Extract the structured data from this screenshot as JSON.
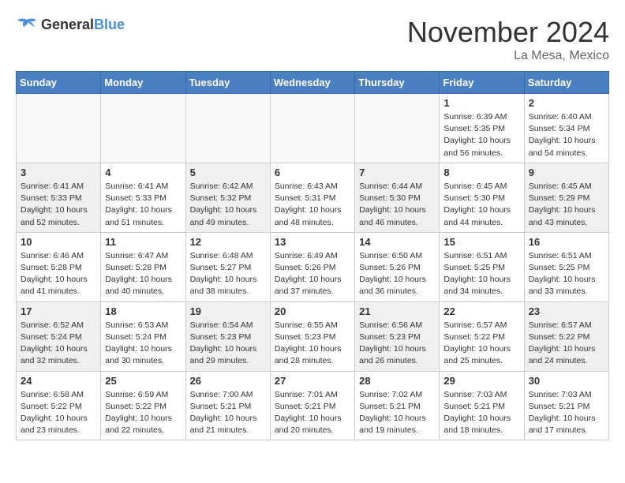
{
  "header": {
    "logo": {
      "general": "General",
      "blue": "Blue"
    },
    "title": "November 2024",
    "location": "La Mesa, Mexico"
  },
  "weekdays": [
    "Sunday",
    "Monday",
    "Tuesday",
    "Wednesday",
    "Thursday",
    "Friday",
    "Saturday"
  ],
  "weeks": [
    [
      {
        "day": null,
        "info": null
      },
      {
        "day": null,
        "info": null
      },
      {
        "day": null,
        "info": null
      },
      {
        "day": null,
        "info": null
      },
      {
        "day": null,
        "info": null
      },
      {
        "day": "1",
        "info": "Sunrise: 6:39 AM\nSunset: 5:35 PM\nDaylight: 10 hours and 56 minutes."
      },
      {
        "day": "2",
        "info": "Sunrise: 6:40 AM\nSunset: 5:34 PM\nDaylight: 10 hours and 54 minutes."
      }
    ],
    [
      {
        "day": "3",
        "info": "Sunrise: 6:41 AM\nSunset: 5:33 PM\nDaylight: 10 hours and 52 minutes."
      },
      {
        "day": "4",
        "info": "Sunrise: 6:41 AM\nSunset: 5:33 PM\nDaylight: 10 hours and 51 minutes."
      },
      {
        "day": "5",
        "info": "Sunrise: 6:42 AM\nSunset: 5:32 PM\nDaylight: 10 hours and 49 minutes."
      },
      {
        "day": "6",
        "info": "Sunrise: 6:43 AM\nSunset: 5:31 PM\nDaylight: 10 hours and 48 minutes."
      },
      {
        "day": "7",
        "info": "Sunrise: 6:44 AM\nSunset: 5:30 PM\nDaylight: 10 hours and 46 minutes."
      },
      {
        "day": "8",
        "info": "Sunrise: 6:45 AM\nSunset: 5:30 PM\nDaylight: 10 hours and 44 minutes."
      },
      {
        "day": "9",
        "info": "Sunrise: 6:45 AM\nSunset: 5:29 PM\nDaylight: 10 hours and 43 minutes."
      }
    ],
    [
      {
        "day": "10",
        "info": "Sunrise: 6:46 AM\nSunset: 5:28 PM\nDaylight: 10 hours and 41 minutes."
      },
      {
        "day": "11",
        "info": "Sunrise: 6:47 AM\nSunset: 5:28 PM\nDaylight: 10 hours and 40 minutes."
      },
      {
        "day": "12",
        "info": "Sunrise: 6:48 AM\nSunset: 5:27 PM\nDaylight: 10 hours and 38 minutes."
      },
      {
        "day": "13",
        "info": "Sunrise: 6:49 AM\nSunset: 5:26 PM\nDaylight: 10 hours and 37 minutes."
      },
      {
        "day": "14",
        "info": "Sunrise: 6:50 AM\nSunset: 5:26 PM\nDaylight: 10 hours and 36 minutes."
      },
      {
        "day": "15",
        "info": "Sunrise: 6:51 AM\nSunset: 5:25 PM\nDaylight: 10 hours and 34 minutes."
      },
      {
        "day": "16",
        "info": "Sunrise: 6:51 AM\nSunset: 5:25 PM\nDaylight: 10 hours and 33 minutes."
      }
    ],
    [
      {
        "day": "17",
        "info": "Sunrise: 6:52 AM\nSunset: 5:24 PM\nDaylight: 10 hours and 32 minutes."
      },
      {
        "day": "18",
        "info": "Sunrise: 6:53 AM\nSunset: 5:24 PM\nDaylight: 10 hours and 30 minutes."
      },
      {
        "day": "19",
        "info": "Sunrise: 6:54 AM\nSunset: 5:23 PM\nDaylight: 10 hours and 29 minutes."
      },
      {
        "day": "20",
        "info": "Sunrise: 6:55 AM\nSunset: 5:23 PM\nDaylight: 10 hours and 28 minutes."
      },
      {
        "day": "21",
        "info": "Sunrise: 6:56 AM\nSunset: 5:23 PM\nDaylight: 10 hours and 26 minutes."
      },
      {
        "day": "22",
        "info": "Sunrise: 6:57 AM\nSunset: 5:22 PM\nDaylight: 10 hours and 25 minutes."
      },
      {
        "day": "23",
        "info": "Sunrise: 6:57 AM\nSunset: 5:22 PM\nDaylight: 10 hours and 24 minutes."
      }
    ],
    [
      {
        "day": "24",
        "info": "Sunrise: 6:58 AM\nSunset: 5:22 PM\nDaylight: 10 hours and 23 minutes."
      },
      {
        "day": "25",
        "info": "Sunrise: 6:59 AM\nSunset: 5:22 PM\nDaylight: 10 hours and 22 minutes."
      },
      {
        "day": "26",
        "info": "Sunrise: 7:00 AM\nSunset: 5:21 PM\nDaylight: 10 hours and 21 minutes."
      },
      {
        "day": "27",
        "info": "Sunrise: 7:01 AM\nSunset: 5:21 PM\nDaylight: 10 hours and 20 minutes."
      },
      {
        "day": "28",
        "info": "Sunrise: 7:02 AM\nSunset: 5:21 PM\nDaylight: 10 hours and 19 minutes."
      },
      {
        "day": "29",
        "info": "Sunrise: 7:03 AM\nSunset: 5:21 PM\nDaylight: 10 hours and 18 minutes."
      },
      {
        "day": "30",
        "info": "Sunrise: 7:03 AM\nSunset: 5:21 PM\nDaylight: 10 hours and 17 minutes."
      }
    ]
  ]
}
